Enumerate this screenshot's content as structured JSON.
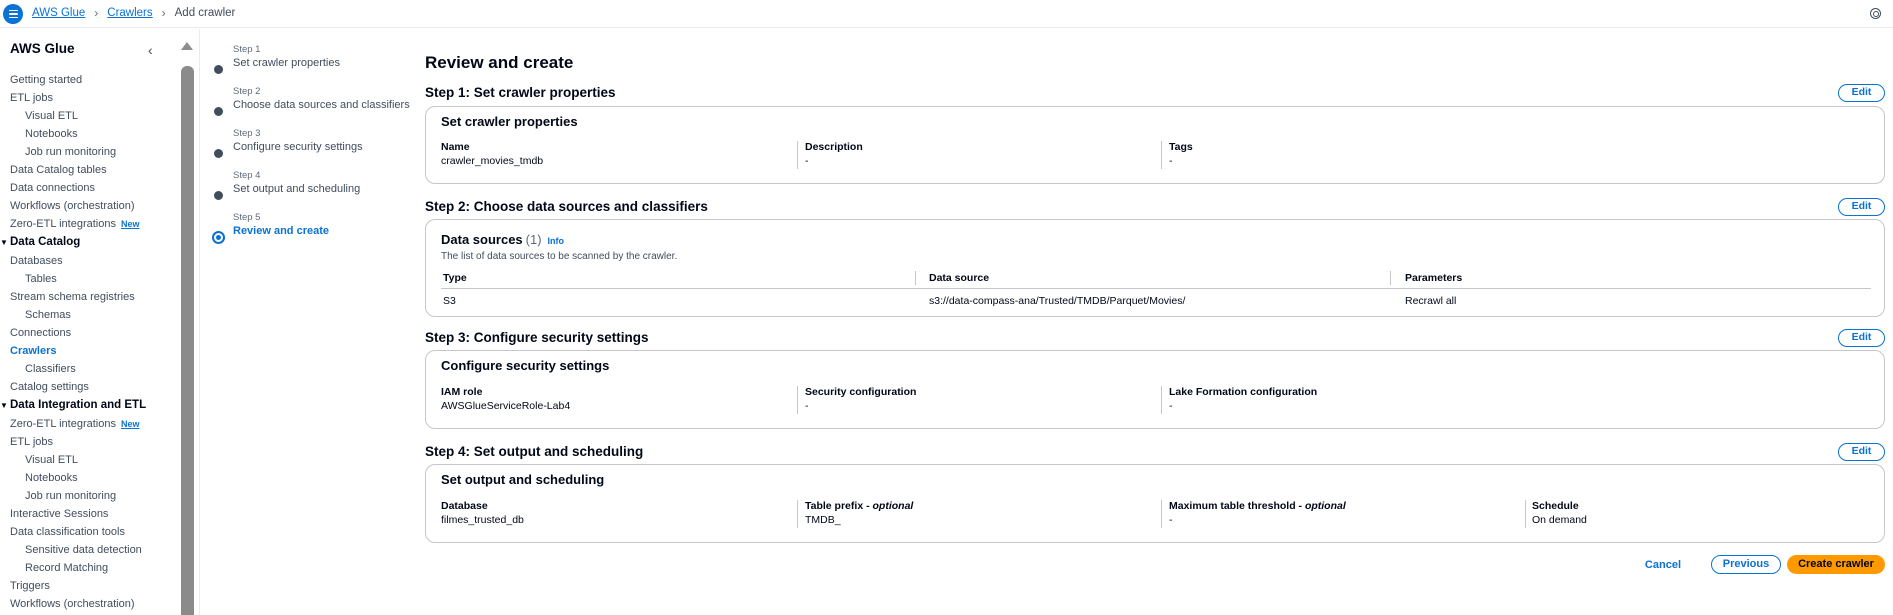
{
  "breadcrumb": [
    "AWS Glue",
    "Crawlers",
    "Add crawler"
  ],
  "sidebar": {
    "title": "AWS Glue",
    "items": [
      {
        "label": "Getting started",
        "level": 1
      },
      {
        "label": "ETL jobs",
        "level": 1
      },
      {
        "label": "Visual ETL",
        "level": 2
      },
      {
        "label": "Notebooks",
        "level": 2
      },
      {
        "label": "Job run monitoring",
        "level": 2
      },
      {
        "label": "Data Catalog tables",
        "level": 1
      },
      {
        "label": "Data connections",
        "level": 1
      },
      {
        "label": "Workflows (orchestration)",
        "level": 1
      },
      {
        "label": "Zero-ETL integrations",
        "level": 1,
        "badge": "New"
      },
      {
        "label": "Data Catalog",
        "level": 0
      },
      {
        "label": "Databases",
        "level": 1
      },
      {
        "label": "Tables",
        "level": 2
      },
      {
        "label": "Stream schema registries",
        "level": 1
      },
      {
        "label": "Schemas",
        "level": 2
      },
      {
        "label": "Connections",
        "level": 1
      },
      {
        "label": "Crawlers",
        "level": 1,
        "active": true
      },
      {
        "label": "Classifiers",
        "level": 2
      },
      {
        "label": "Catalog settings",
        "level": 1
      },
      {
        "label": "Data Integration and ETL",
        "level": 0
      },
      {
        "label": "Zero-ETL integrations",
        "level": 1,
        "badge": "New"
      },
      {
        "label": "ETL jobs",
        "level": 1
      },
      {
        "label": "Visual ETL",
        "level": 2
      },
      {
        "label": "Notebooks",
        "level": 2
      },
      {
        "label": "Job run monitoring",
        "level": 2
      },
      {
        "label": "Interactive Sessions",
        "level": 1
      },
      {
        "label": "Data classification tools",
        "level": 1
      },
      {
        "label": "Sensitive data detection",
        "level": 2
      },
      {
        "label": "Record Matching",
        "level": 2
      },
      {
        "label": "Triggers",
        "level": 1
      },
      {
        "label": "Workflows (orchestration)",
        "level": 1
      }
    ]
  },
  "steps": [
    {
      "num": "Step 1",
      "label": "Set crawler properties",
      "active": false
    },
    {
      "num": "Step 2",
      "label": "Choose data sources and classifiers",
      "active": false
    },
    {
      "num": "Step 3",
      "label": "Configure security settings",
      "active": false
    },
    {
      "num": "Step 4",
      "label": "Set output and scheduling",
      "active": false
    },
    {
      "num": "Step 5",
      "label": "Review and create",
      "active": true
    }
  ],
  "main": {
    "title": "Review and create",
    "edit_label": "Edit",
    "s1": {
      "heading": "Step 1: Set crawler properties",
      "card_title": "Set crawler properties",
      "fields": [
        {
          "key": "Name",
          "value": "crawler_movies_tmdb"
        },
        {
          "key": "Description",
          "value": "-"
        },
        {
          "key": "Tags",
          "value": "-"
        }
      ]
    },
    "s2": {
      "heading": "Step 2: Choose data sources and classifiers",
      "ds_title": "Data sources",
      "ds_count": "(1)",
      "info": "Info",
      "desc": "The list of data sources to be scanned by the crawler.",
      "columns": [
        "Type",
        "Data source",
        "Parameters"
      ],
      "row": [
        "S3",
        "s3://data-compass-ana/Trusted/TMDB/Parquet/Movies/",
        "Recrawl all"
      ]
    },
    "s3": {
      "heading": "Step 3: Configure security settings",
      "card_title": "Configure security settings",
      "fields": [
        {
          "key": "IAM role",
          "value": "AWSGlueServiceRole-Lab4"
        },
        {
          "key": "Security configuration",
          "value": "-"
        },
        {
          "key": "Lake Formation configuration",
          "value": "-"
        }
      ]
    },
    "s4": {
      "heading": "Step 4: Set output and scheduling",
      "card_title": "Set output and scheduling",
      "optional": "optional",
      "fields": [
        {
          "key": "Database",
          "value": "filmes_trusted_db"
        },
        {
          "key": "Table prefix - ",
          "value": "TMDB_"
        },
        {
          "key": "Maximum table threshold - ",
          "value": "-"
        },
        {
          "key": "Schedule",
          "value": "On demand"
        }
      ]
    }
  },
  "footer": {
    "cancel": "Cancel",
    "previous": "Previous",
    "create": "Create crawler"
  }
}
